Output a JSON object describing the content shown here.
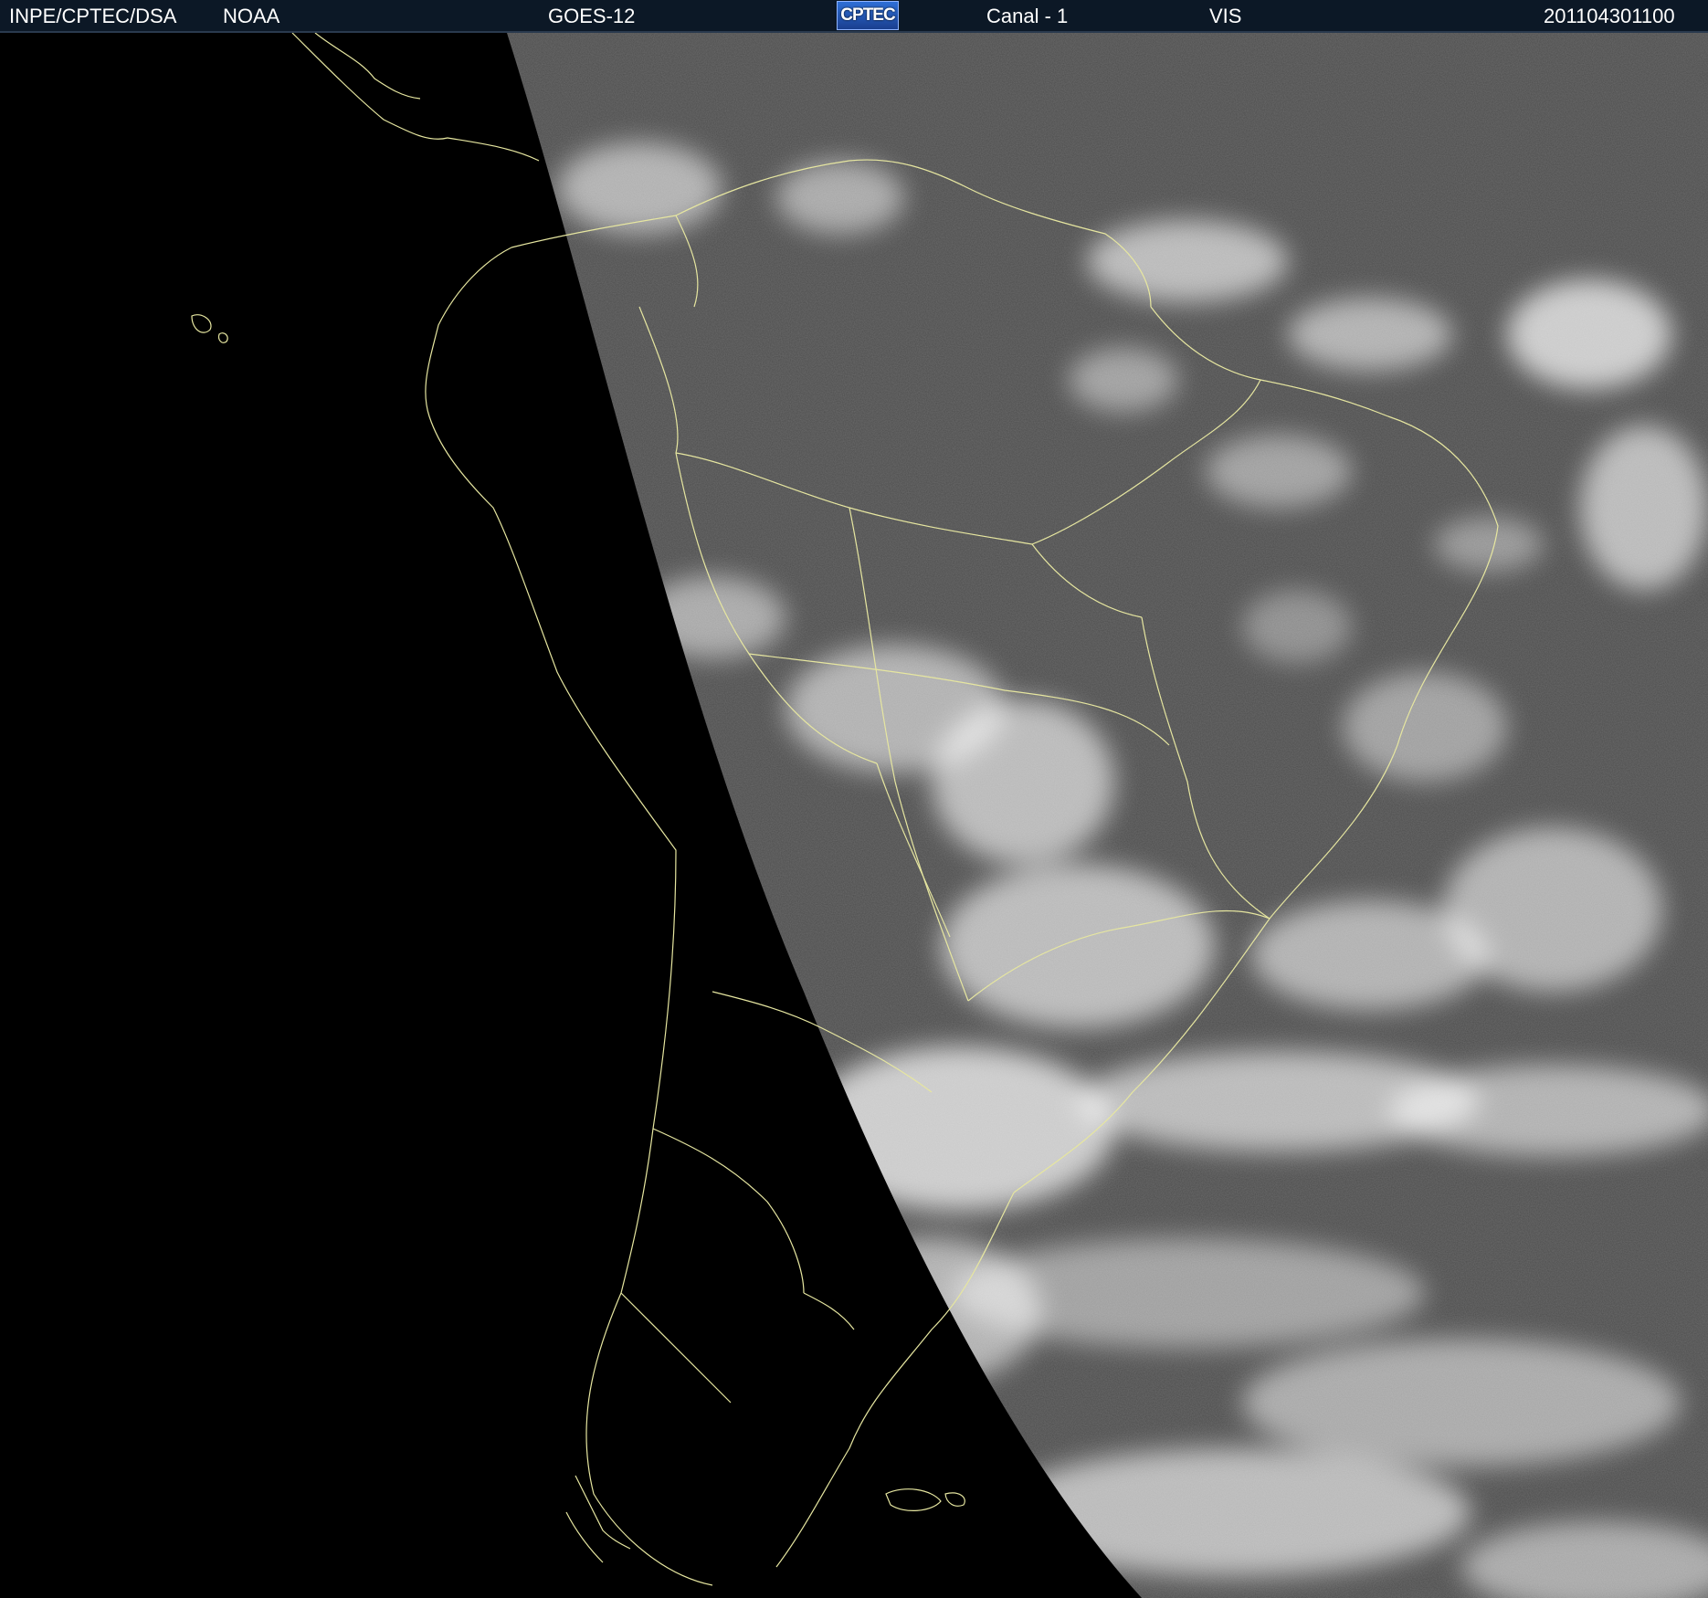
{
  "header": {
    "org": "INPE/CPTEC/DSA",
    "agency": "NOAA",
    "satellite": "GOES-12",
    "logo_text": "CPTEC",
    "channel": "Canal - 1",
    "band": "VIS",
    "timestamp": "201104301100"
  },
  "map": {
    "background_color": "#000000",
    "coastline_color": "#e6e6a0",
    "cloud_color": "#ffffff",
    "surface_color": "#4a4a4a"
  }
}
